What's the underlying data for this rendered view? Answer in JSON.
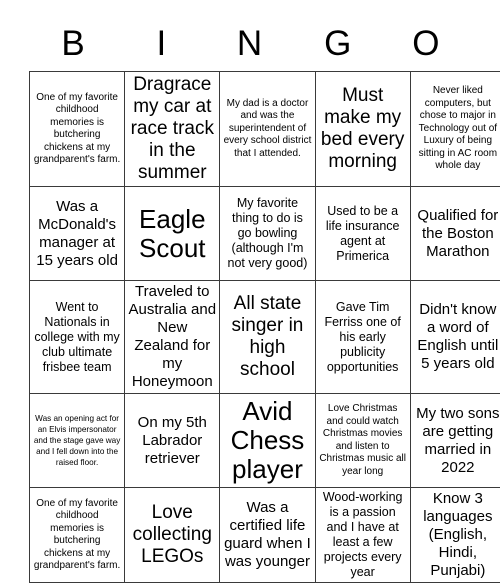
{
  "header": {
    "letters": [
      "B",
      "I",
      "N",
      "G",
      "O"
    ]
  },
  "grid": {
    "rows": 5,
    "columns": 5,
    "cells": [
      [
        {
          "text": "One of my favorite childhood memories is butchering chickens at my grandparent's farm.",
          "size": "sm"
        },
        {
          "text": "Dragrace my car at race track in the summer",
          "size": "xl"
        },
        {
          "text": "My dad is a doctor and was the superintendent of every school district that I attended.",
          "size": "sm"
        },
        {
          "text": "Must make my bed every morning",
          "size": "xl"
        },
        {
          "text": "Never liked computers, but chose to major in Technology out of Luxury of being sitting in AC room whole day",
          "size": "sm"
        }
      ],
      [
        {
          "text": "Was a McDonald's manager at 15 years old",
          "size": "lg"
        },
        {
          "text": "Eagle Scout",
          "size": "xxl"
        },
        {
          "text": "My favorite thing to do is go bowling (although I'm not very good)",
          "size": "md"
        },
        {
          "text": "Used to be a life insurance agent at Primerica",
          "size": "md"
        },
        {
          "text": "Qualified for the Boston Marathon",
          "size": "lg"
        }
      ],
      [
        {
          "text": "Went to Nationals in college with my club ultimate frisbee team",
          "size": "md"
        },
        {
          "text": "Traveled to Australia and New Zealand for my Honeymoon",
          "size": "lg"
        },
        {
          "text": "All state singer in high school",
          "size": "xl"
        },
        {
          "text": "Gave Tim Ferriss one of his early publicity opportunities",
          "size": "md"
        },
        {
          "text": "Didn't know a word of English until 5 years old",
          "size": "lg"
        }
      ],
      [
        {
          "text": "Was an opening act for an Elvis impersonator and the stage gave way and I fell down into the raised floor.",
          "size": "xs"
        },
        {
          "text": "On my 5th Labrador retriever",
          "size": "lg"
        },
        {
          "text": "Avid Chess player",
          "size": "xxl"
        },
        {
          "text": "Love Christmas and could watch Christmas movies and listen to Christmas music all year long",
          "size": "sm"
        },
        {
          "text": "My two sons are getting married in 2022",
          "size": "lg"
        }
      ],
      [
        {
          "text": "One of my favorite childhood memories is butchering chickens at my grandparent's farm.",
          "size": "sm"
        },
        {
          "text": "Love collecting LEGOs",
          "size": "xl"
        },
        {
          "text": "Was a certified life guard when I was younger",
          "size": "lg"
        },
        {
          "text": "Wood-working is a passion and I have at least a few projects every year",
          "size": "md"
        },
        {
          "text": "Know 3 languages (English, Hindi, Punjabi)",
          "size": "lg"
        }
      ]
    ]
  },
  "colors": {
    "background": "#ffffff",
    "text": "#000000",
    "border": "#3a3a3a"
  }
}
